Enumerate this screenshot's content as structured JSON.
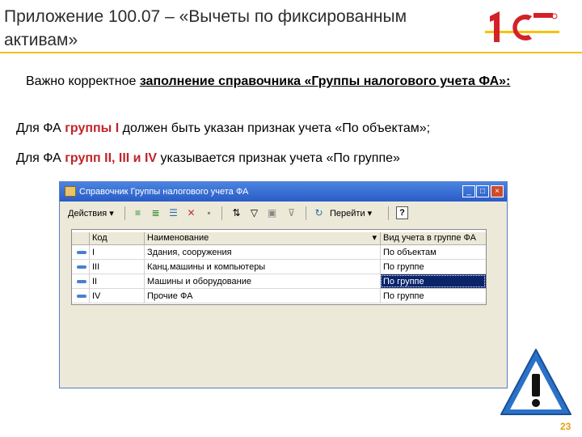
{
  "slide": {
    "title": "Приложение 100.07 – «Вычеты по фиксированным активам»",
    "logo_text": "1С",
    "note_prefix": "Важно корректное ",
    "note_underlined": "заполнение справочника «Группы налогового учета ФА»:",
    "p1_a": "Для ФА ",
    "p1_red": "группы I",
    "p1_b": " должен быть указан признак учета «По объектам»;",
    "p2_a": "Для ФА ",
    "p2_red": "групп II, III и IV",
    "p2_b": " указывается признак учета «По группе»",
    "page_number": "23"
  },
  "window": {
    "title": "Справочник Группы налогового учета ФА",
    "actions_menu": "Действия ▾",
    "goto_menu": "Перейти ▾",
    "help_label": "?",
    "minimize": "_",
    "maximize": "□",
    "close": "×"
  },
  "table": {
    "headers": [
      "Код",
      "Наименование",
      "Вид учета в группе ФА"
    ],
    "sort_indicator": "▾",
    "rows": [
      {
        "code": "I",
        "name": "Здания, сооружения",
        "method": "По объектам"
      },
      {
        "code": "III",
        "name": "Канц.машины и компьютеры",
        "method": "По группе"
      },
      {
        "code": "II",
        "name": "Машины и оборудование",
        "method": "По группе"
      },
      {
        "code": "IV",
        "name": "Прочие ФА",
        "method": "По группе"
      }
    ],
    "selected_row": 2
  },
  "colors": {
    "accent_red": "#c0242a",
    "logo_red": "#d42127",
    "logo_yellow": "#f5c400",
    "titlebar": "#2a5cc7",
    "selection": "#0a246a",
    "warning_blue": "#2a72c8"
  }
}
